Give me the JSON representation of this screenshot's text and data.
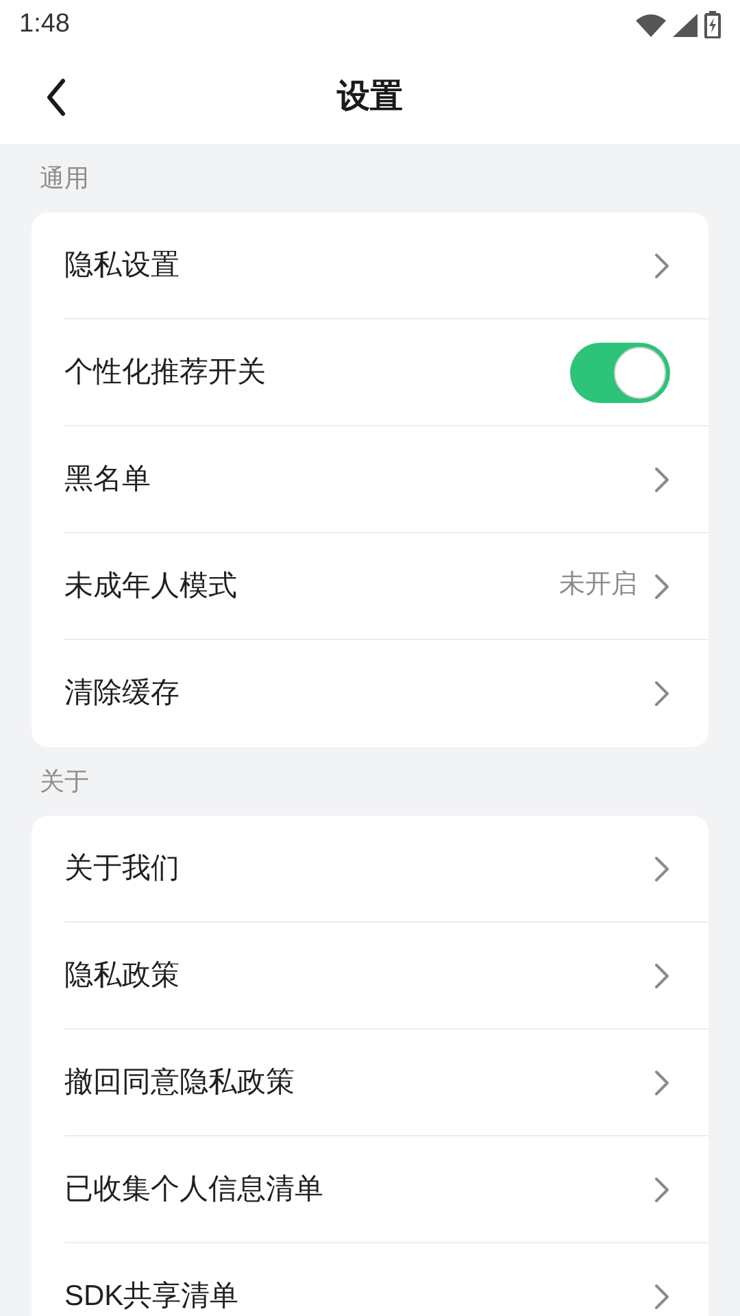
{
  "status_bar": {
    "time": "1:48"
  },
  "header": {
    "title": "设置"
  },
  "sections": [
    {
      "title": "通用",
      "items": [
        {
          "kind": "link",
          "label": "隐私设置"
        },
        {
          "kind": "toggle",
          "label": "个性化推荐开关",
          "on": true
        },
        {
          "kind": "link",
          "label": "黑名单"
        },
        {
          "kind": "link",
          "label": "未成年人模式",
          "value": "未开启"
        },
        {
          "kind": "link",
          "label": "清除缓存"
        }
      ]
    },
    {
      "title": "关于",
      "items": [
        {
          "kind": "link",
          "label": "关于我们"
        },
        {
          "kind": "link",
          "label": "隐私政策"
        },
        {
          "kind": "link",
          "label": "撤回同意隐私政策"
        },
        {
          "kind": "link",
          "label": "已收集个人信息清单"
        },
        {
          "kind": "link",
          "label": "SDK共享清单"
        }
      ]
    }
  ]
}
